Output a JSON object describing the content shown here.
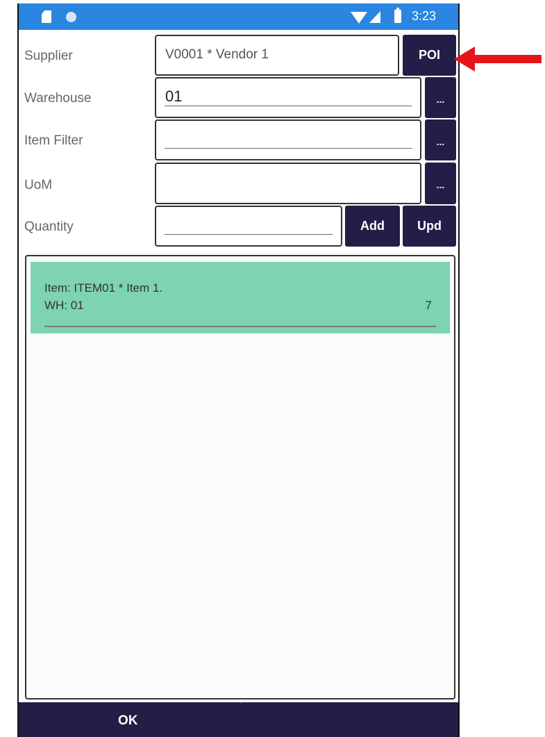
{
  "status_bar": {
    "time": "3:23",
    "icons": [
      "sd-card-icon",
      "circle-icon",
      "wifi-icon",
      "signal-icon",
      "battery-icon"
    ]
  },
  "form": {
    "supplier": {
      "label": "Supplier",
      "value": "V0001 * Vendor 1",
      "button": "POI"
    },
    "warehouse": {
      "label": "Warehouse",
      "value": "01",
      "button": "..."
    },
    "item_filter": {
      "label": "Item Filter",
      "value": "",
      "button": "..."
    },
    "uom": {
      "label": "UoM",
      "value": "",
      "button": "..."
    },
    "quantity": {
      "label": "Quantity",
      "value": "",
      "add_button": "Add",
      "upd_button": "Upd"
    }
  },
  "list": {
    "items": [
      {
        "line1": "Item: ITEM01 * Item 1.",
        "line2": "WH: 01",
        "quantity": "7"
      }
    ]
  },
  "footer": {
    "ok_label": "OK"
  },
  "colors": {
    "status_bar": "#2a86e0",
    "button": "#221e48",
    "item_highlight": "#7dd3b2",
    "annotation_arrow": "#e8141b"
  }
}
